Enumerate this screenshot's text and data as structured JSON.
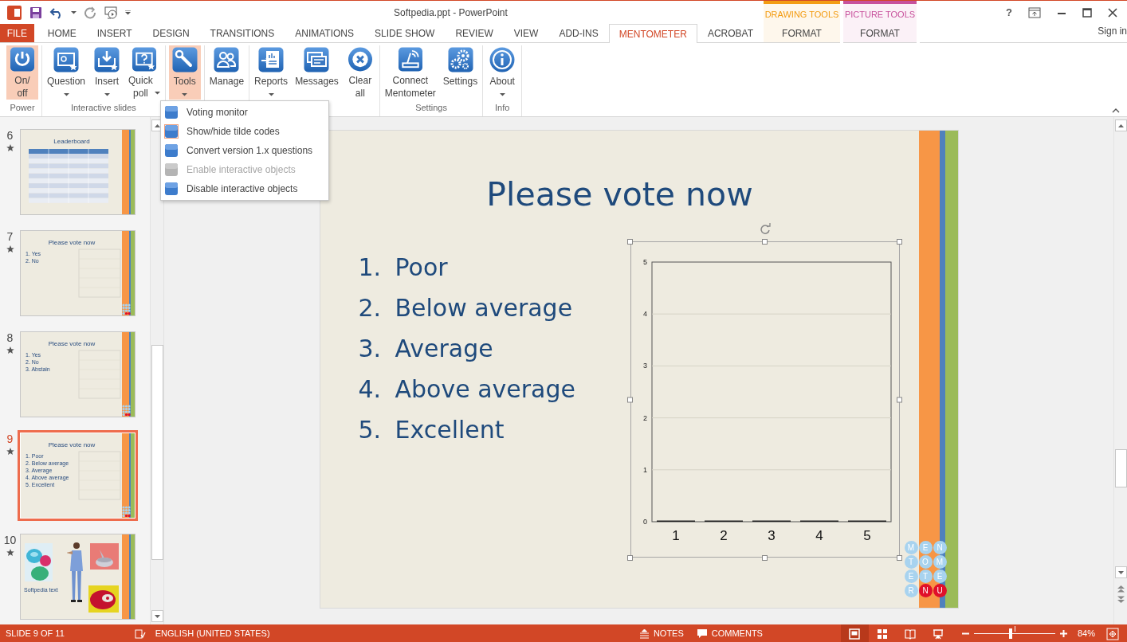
{
  "title": "Softpedia.ppt - PowerPoint",
  "help": "?",
  "sign_in": "Sign in",
  "tabs": [
    {
      "label": "FILE",
      "kind": "file",
      "selected": false
    },
    {
      "label": "HOME",
      "kind": "normal",
      "selected": false
    },
    {
      "label": "INSERT",
      "kind": "normal",
      "selected": false
    },
    {
      "label": "DESIGN",
      "kind": "normal",
      "selected": false
    },
    {
      "label": "TRANSITIONS",
      "kind": "normal",
      "selected": false
    },
    {
      "label": "ANIMATIONS",
      "kind": "normal",
      "selected": false
    },
    {
      "label": "SLIDE SHOW",
      "kind": "normal",
      "selected": false
    },
    {
      "label": "REVIEW",
      "kind": "normal",
      "selected": false
    },
    {
      "label": "VIEW",
      "kind": "normal",
      "selected": false
    },
    {
      "label": "ADD-INS",
      "kind": "normal",
      "selected": false
    },
    {
      "label": "MENTOMETER",
      "kind": "normal",
      "selected": true
    },
    {
      "label": "ACROBAT",
      "kind": "normal",
      "selected": false
    }
  ],
  "context_tabs": [
    {
      "group": "DRAWING TOOLS",
      "label": "FORMAT",
      "color": "#f39c12",
      "selected": false
    },
    {
      "group": "PICTURE TOOLS",
      "label": "FORMAT",
      "color": "#c8519c",
      "selected": false
    }
  ],
  "ribbon_groups": [
    {
      "label": "Power",
      "buttons": [
        {
          "label": "On/\noff",
          "kind": "power",
          "selected": true,
          "dropdown": false
        }
      ]
    },
    {
      "label": "Interactive slides",
      "buttons": [
        {
          "label": "Question",
          "kind": "question",
          "selected": false,
          "dropdown": true
        },
        {
          "label": "Insert",
          "kind": "insert",
          "selected": false,
          "dropdown": true
        },
        {
          "label": "Quick\npoll",
          "kind": "poll",
          "selected": false,
          "dropdown": true
        }
      ]
    },
    {
      "buttons": [
        {
          "label": "Tools",
          "kind": "tools",
          "selected": true,
          "dropdown": true
        }
      ]
    },
    {
      "buttons": [
        {
          "label": "Manage",
          "kind": "manage",
          "selected": false,
          "dropdown": false
        }
      ]
    },
    {
      "buttons": [
        {
          "label": "Reports",
          "kind": "reports",
          "selected": false,
          "dropdown": true
        },
        {
          "label": "Messages",
          "kind": "messages",
          "selected": false,
          "dropdown": false
        },
        {
          "label": "Clear\nall",
          "kind": "clear",
          "selected": false,
          "dropdown": false
        }
      ]
    },
    {
      "label": "Settings",
      "buttons": [
        {
          "label": "Connect\nMentometer",
          "kind": "connect",
          "selected": false,
          "dropdown": false
        },
        {
          "label": "Settings",
          "kind": "settings",
          "selected": false,
          "dropdown": false
        }
      ]
    },
    {
      "label": "Info",
      "buttons": [
        {
          "label": "About",
          "kind": "about",
          "selected": false,
          "dropdown": true
        }
      ]
    }
  ],
  "tools_menu": [
    {
      "label": "Voting monitor",
      "disabled": false,
      "selected": false
    },
    {
      "label": "Show/hide tilde codes",
      "disabled": false,
      "selected": true
    },
    {
      "label": "Convert version 1.x questions",
      "disabled": false,
      "selected": false
    },
    {
      "label": "Enable interactive objects",
      "disabled": true,
      "selected": false
    },
    {
      "label": "Disable interactive objects",
      "disabled": false,
      "selected": false
    }
  ],
  "slides": [
    {
      "number": "6",
      "kind": "table",
      "title": "Leaderboard",
      "selected": false
    },
    {
      "number": "7",
      "kind": "poll",
      "title": "Please vote now",
      "items": [
        {
          "number": "1.",
          "text": "Yes"
        },
        {
          "number": "2.",
          "text": "No"
        }
      ],
      "selected": false
    },
    {
      "number": "8",
      "kind": "poll",
      "title": "Please vote now",
      "items": [
        {
          "number": "1.",
          "text": "Yes"
        },
        {
          "number": "2.",
          "text": "No"
        },
        {
          "number": "3.",
          "text": "Abstain"
        }
      ],
      "selected": false
    },
    {
      "number": "9",
      "kind": "poll",
      "title": "Please vote now",
      "items": [
        {
          "number": "1.",
          "text": "Poor"
        },
        {
          "number": "2.",
          "text": "Below average"
        },
        {
          "number": "3.",
          "text": "Average"
        },
        {
          "number": "4.",
          "text": "Above average"
        },
        {
          "number": "5.",
          "text": "Excellent"
        }
      ],
      "selected": true
    },
    {
      "number": "10",
      "kind": "photos",
      "caption": "Softpedia text",
      "selected": false
    }
  ],
  "current_slide": {
    "title": "Please vote now",
    "items": [
      {
        "number": "1.",
        "text": "Poor"
      },
      {
        "number": "2.",
        "text": "Below average"
      },
      {
        "number": "3.",
        "text": "Average"
      },
      {
        "number": "4.",
        "text": "Above average"
      },
      {
        "number": "5.",
        "text": "Excellent"
      }
    ],
    "chart_data": {
      "type": "bar",
      "grid": true,
      "categories": [
        "1",
        "2",
        "3",
        "4",
        "5"
      ],
      "series": [
        {
          "color": "#1f1f1f",
          "values": [
            0,
            0,
            0,
            0,
            0
          ]
        }
      ],
      "ylim": [
        0,
        5
      ],
      "yticks": [
        0,
        1,
        2,
        3,
        4,
        5
      ]
    },
    "logo": [
      {
        "char": "M",
        "color": "#a8d3ef"
      },
      {
        "char": "E",
        "color": "#a8d3ef"
      },
      {
        "char": "N",
        "color": "#a8d3ef"
      },
      {
        "char": "T",
        "color": "#a8d3ef"
      },
      {
        "char": "O",
        "color": "#a8d3ef"
      },
      {
        "char": "M",
        "color": "#a8d3ef"
      },
      {
        "char": "E",
        "color": "#a8d3ef"
      },
      {
        "char": "T",
        "color": "#a8d3ef"
      },
      {
        "char": "E",
        "color": "#a8d3ef"
      },
      {
        "char": "R",
        "color": "#a8d3ef"
      },
      {
        "char": "N",
        "color": "#e0102a"
      },
      {
        "char": "U",
        "color": "#e0102a"
      }
    ]
  },
  "status_bar": {
    "slide_counter": "SLIDE 9 OF 11",
    "language": "ENGLISH (UNITED STATES)",
    "notes": "NOTES",
    "comments": "COMMENTS",
    "views": [
      {
        "kind": "normal",
        "selected": true
      },
      {
        "kind": "sorter",
        "selected": false
      },
      {
        "kind": "reading",
        "selected": false
      },
      {
        "kind": "slideshow",
        "selected": false
      }
    ],
    "zoom": {
      "level": 0.45,
      "reading": "84%"
    }
  }
}
